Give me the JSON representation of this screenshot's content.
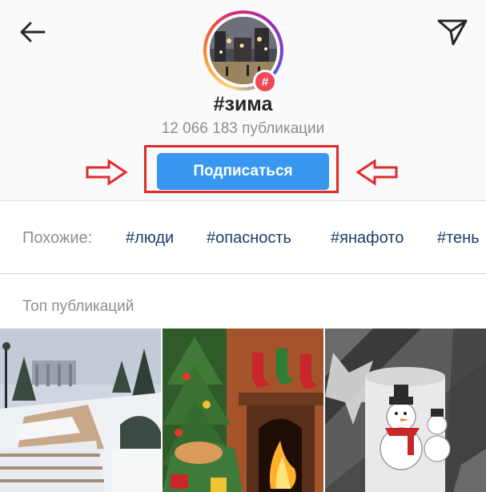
{
  "header": {
    "title": "#зима",
    "post_count": "12 066 183 публикации",
    "follow_label": "Подписаться",
    "badge": "#"
  },
  "icons": {
    "back": "arrow-left-icon",
    "send": "paper-plane-icon",
    "badge": "hashtag-icon"
  },
  "similar": {
    "label": "Похожие:",
    "tags": [
      "#люди",
      "#опасность",
      "#янафото",
      "#тень"
    ]
  },
  "top_posts": {
    "title": "Топ публикаций",
    "items": [
      "snowy-park-photo",
      "christmas-fireplace-illustration",
      "snowman-candle-photo"
    ]
  },
  "colors": {
    "accent": "#3897f0",
    "highlight": "#e02b2b",
    "tag_link": "#1e3d6b",
    "badge": "#ed4956"
  }
}
